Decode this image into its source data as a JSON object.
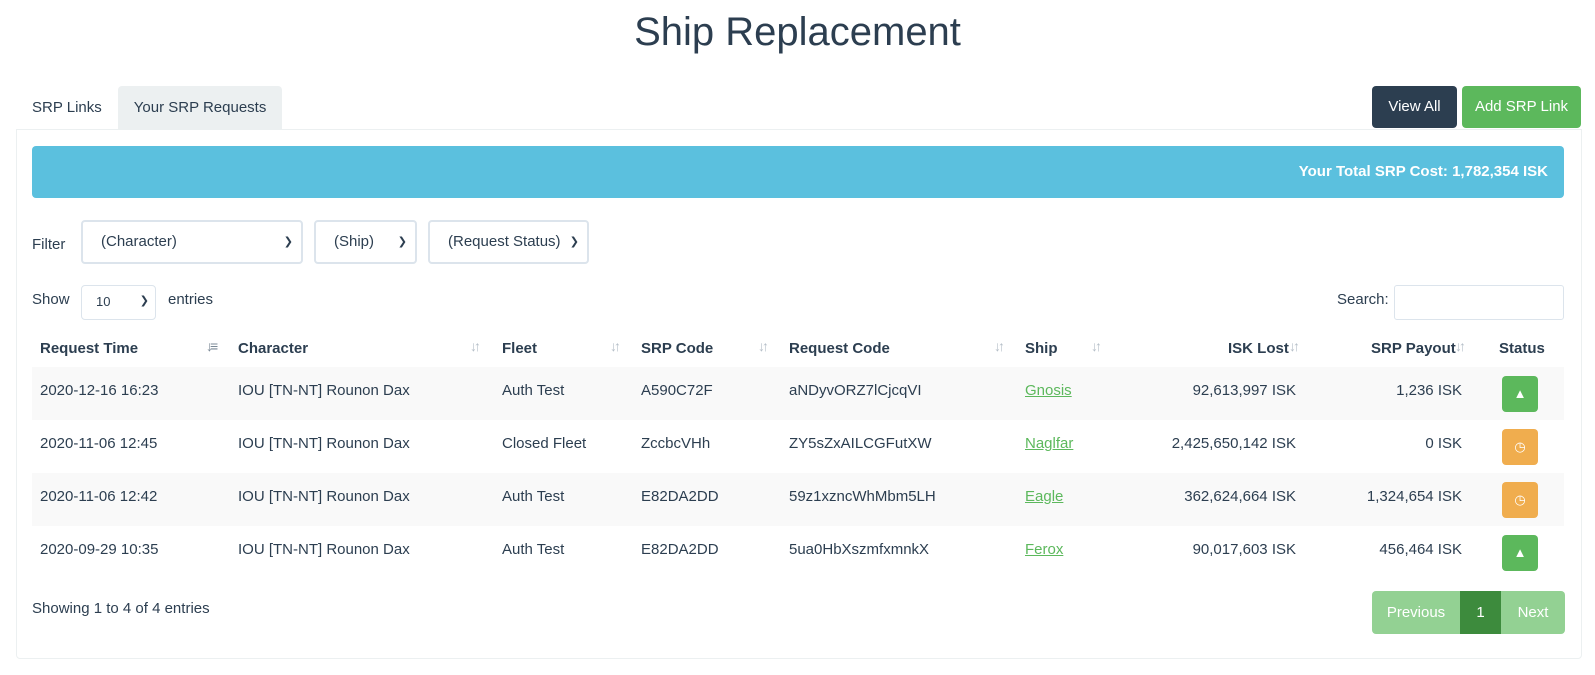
{
  "page_title": "Ship Replacement",
  "tabs": [
    {
      "label": "SRP Links",
      "active": false
    },
    {
      "label": "Your SRP Requests",
      "active": true
    }
  ],
  "buttons": {
    "view_all": "View All",
    "add_srp_link": "Add SRP Link"
  },
  "alert": {
    "total_label": "Your Total SRP Cost: 1,782,354 ISK"
  },
  "filter": {
    "label": "Filter",
    "character": "(Character)",
    "ship": "(Ship)",
    "status": "(Request Status)"
  },
  "length": {
    "show": "Show",
    "value": "10",
    "entries": "entries"
  },
  "search": {
    "label": "Search:",
    "value": ""
  },
  "table": {
    "headers": [
      "Request Time",
      "Character",
      "Fleet",
      "SRP Code",
      "Request Code",
      "Ship",
      "ISK Lost",
      "SRP Payout",
      "Status"
    ],
    "rows": [
      {
        "time": "2020-12-16 16:23",
        "character": "IOU [TN-NT] Rounon Dax",
        "fleet": "Auth Test",
        "srp_code": "A590C72F",
        "request_code": "aNDyvORZ7lCjcqVI",
        "ship": "Gnosis",
        "isk_lost": "92,613,997 ISK",
        "payout": "1,236 ISK",
        "status": "approved",
        "status_icon": "thumbs-up-icon"
      },
      {
        "time": "2020-11-06 12:45",
        "character": "IOU [TN-NT] Rounon Dax",
        "fleet": "Closed Fleet",
        "srp_code": "ZccbcVHh",
        "request_code": "ZY5sZxAILCGFutXW",
        "ship": "Naglfar",
        "isk_lost": "2,425,650,142 ISK",
        "payout": "0 ISK",
        "status": "pending",
        "status_icon": "clock-icon"
      },
      {
        "time": "2020-11-06 12:42",
        "character": "IOU [TN-NT] Rounon Dax",
        "fleet": "Auth Test",
        "srp_code": "E82DA2DD",
        "request_code": "59z1xzncWhMbm5LH",
        "ship": "Eagle",
        "isk_lost": "362,624,664 ISK",
        "payout": "1,324,654 ISK",
        "status": "pending",
        "status_icon": "clock-icon"
      },
      {
        "time": "2020-09-29 10:35",
        "character": "IOU [TN-NT] Rounon Dax",
        "fleet": "Auth Test",
        "srp_code": "E82DA2DD",
        "request_code": "5ua0HbXszmfxmnkX",
        "ship": "Ferox",
        "isk_lost": "90,017,603 ISK",
        "payout": "456,464 ISK",
        "status": "approved",
        "status_icon": "thumbs-up-icon"
      }
    ]
  },
  "info": "Showing 1 to 4 of 4 entries",
  "pagination": {
    "previous": "Previous",
    "page": "1",
    "next": "Next"
  },
  "colors": {
    "primary": "#2c3e50",
    "success": "#5cb85c",
    "info": "#5bc0de",
    "warning": "#f0ad4e"
  }
}
